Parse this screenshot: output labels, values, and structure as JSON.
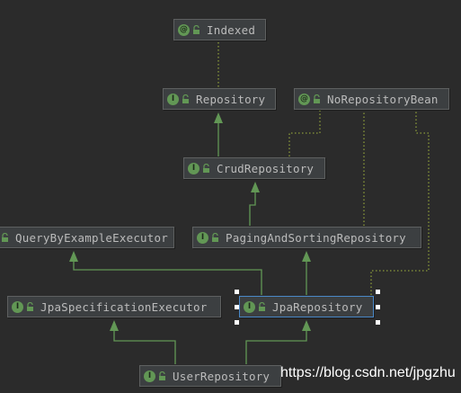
{
  "diagram": {
    "nodes": [
      {
        "id": "indexed",
        "label": "Indexed",
        "kind_letter": "@",
        "kind": "annotation"
      },
      {
        "id": "repository",
        "label": "Repository",
        "kind_letter": "I",
        "kind": "interface"
      },
      {
        "id": "norepositorybean",
        "label": "NoRepositoryBean",
        "kind_letter": "@",
        "kind": "annotation"
      },
      {
        "id": "crudrepository",
        "label": "CrudRepository",
        "kind_letter": "I",
        "kind": "interface"
      },
      {
        "id": "querybyexampleexecutor",
        "label": "QueryByExampleExecutor",
        "kind_letter": "I",
        "kind": "interface"
      },
      {
        "id": "pagingandsortingrepository",
        "label": "PagingAndSortingRepository",
        "kind_letter": "I",
        "kind": "interface"
      },
      {
        "id": "jpaspecificationexecutor",
        "label": "JpaSpecificationExecutor",
        "kind_letter": "I",
        "kind": "interface"
      },
      {
        "id": "jparepository",
        "label": "JpaRepository",
        "kind_letter": "I",
        "kind": "interface",
        "selected": true
      },
      {
        "id": "userrepository",
        "label": "UserRepository",
        "kind_letter": "I",
        "kind": "interface"
      }
    ],
    "colors": {
      "background": "#2b2b2b",
      "node_fill": "#3c3f41",
      "node_border": "#5e6060",
      "selected_border": "#4a88c7",
      "inheritance_edge": "#629755",
      "annotation_edge": "#8a9a3a",
      "icon_green": "#629755"
    }
  },
  "watermark": {
    "text": "https://blog.csdn.net/jpgzhu"
  }
}
